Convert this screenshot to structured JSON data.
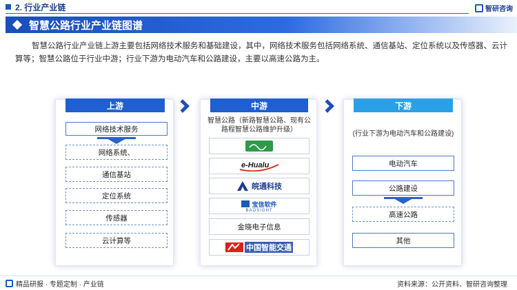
{
  "header": {
    "section_title": "2. 行业产业链",
    "brand": "智研咨询"
  },
  "title_bar": {
    "title": "智慧公路行业产业链图谱"
  },
  "description": "智慧公路行业产业链上游主要包括网络技术服务和基础建设，其中，网络技术服务包括网络系统、通信基站、定位系统以及传感器、云计算等；智慧公路位于行业中游；行业下游为电动汽车和公路建设，主要以高速公路为主。",
  "upstream": {
    "label": "上游",
    "main_item": "网络技术服务",
    "items": [
      "网络系统、",
      "通信基站",
      "定位系统",
      "传感器",
      "云计算等"
    ]
  },
  "midstream": {
    "label": "中游",
    "note": "智慧公路（新路智慧公路、现有公路程智慧公路维护升级）",
    "logos": [
      {
        "name": "logo-1",
        "text": "",
        "icon": "green-calligraphy-logo"
      },
      {
        "name": "logo-2",
        "text": "e-Hualu",
        "icon": "hualu-logo"
      },
      {
        "name": "logo-3",
        "text": "皖通科技",
        "icon": "wantong-logo"
      },
      {
        "name": "logo-4",
        "text": "宝信软件",
        "subtext": "BAOSIGHT",
        "icon": "baosight-logo"
      },
      {
        "name": "logo-5",
        "text": "金晓电子信息",
        "icon": ""
      },
      {
        "name": "logo-6",
        "text": "中国智能交通",
        "icon": "china-its-logo"
      }
    ]
  },
  "downstream": {
    "label": "下游",
    "note": "(行业下游为电动汽车和公路建设)",
    "items": [
      "电动汽车",
      "公路建设",
      "高速公路",
      "其他"
    ]
  },
  "footer": {
    "left": "精品研报 · 专题定制 · 产业链",
    "right": "资料来源：公开资料、智研咨询整理"
  },
  "colors": {
    "primary": "#1f5fd0",
    "light": "#2ba0e6"
  }
}
